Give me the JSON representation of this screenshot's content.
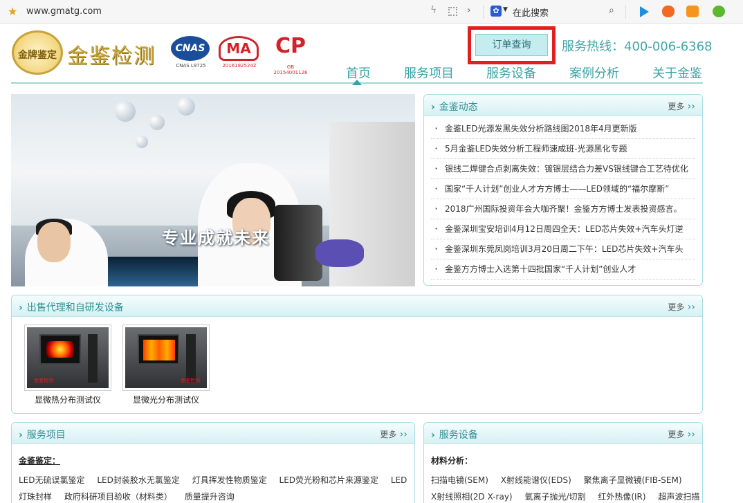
{
  "browser": {
    "url": "www.gmatg.com",
    "search_label": "在此搜索"
  },
  "header": {
    "logo_seal_text": "金牌鉴定",
    "logo_text": "金鉴检测",
    "certs": [
      {
        "name": "CNAS",
        "caption": "CNAS L9725"
      },
      {
        "name": "MA",
        "caption": "2016192524Z"
      },
      {
        "name": "CP",
        "caption": "GB 20154001126"
      }
    ],
    "order_button": "订单查询",
    "hotline": "服务热线：400-006-6368"
  },
  "nav": [
    "首页",
    "服务项目",
    "服务设备",
    "案例分析",
    "关于金鉴"
  ],
  "hero": {
    "caption": "专业成就未来"
  },
  "news": {
    "title": "金鉴动态",
    "more": "更多",
    "items": [
      "金鉴LED光源发黑失效分析路线图2018年4月更新版",
      "5月金鉴LED失效分析工程师速成班-光源黑化专题",
      "银线二焊健合点剥离失效：镀银层结合力差VS银线键合工艺待优化",
      "国家“千人计划”创业人才方方博士——LED领域的“福尔摩斯”",
      "2018广州国际投资年会大咖齐聚！金鉴方方博士发表投资感言。",
      "金鉴深圳宝安培训4月12日周四全天：LED芯片失效+汽车头灯逆",
      "金鉴深圳东莞凤岗培训3月20日周二下午：LED芯片失效+汽车头",
      "金鉴方方博士入选第十四批国家“千人计划”创业人才"
    ]
  },
  "equipment_sale": {
    "title": "出售代理和自研发设备",
    "more": "更多",
    "products": [
      {
        "name": "显微热分布测试仪",
        "mark": "金鉴检测"
      },
      {
        "name": "显微光分布测试仪",
        "mark": "金鉴检测"
      }
    ]
  },
  "services": {
    "title": "服务项目",
    "more": "更多",
    "subtitle": "金鉴鉴定：",
    "row1": [
      "LED无硫误氯鉴定",
      "LED封装胶水无氯鉴定",
      "灯具挥发性物质鉴定",
      "LED荧光粉和芯片来源鉴定",
      "LED"
    ],
    "row2": [
      "灯珠封样",
      "政府科研项目验收（材料类）",
      "质量提升咨询"
    ]
  },
  "devices": {
    "title": "服务设备",
    "more": "更多",
    "subtitle": "材料分析：",
    "row1": [
      "扫描电镜(SEM)",
      "X射线能谱仪(EDS)",
      "聚焦离子显微镜(FIB-SEM)"
    ],
    "row2": [
      "X射线照相(2D X-ray)",
      "氩离子抛光/切割",
      "红外热像(IR)",
      "超声波扫描"
    ]
  }
}
